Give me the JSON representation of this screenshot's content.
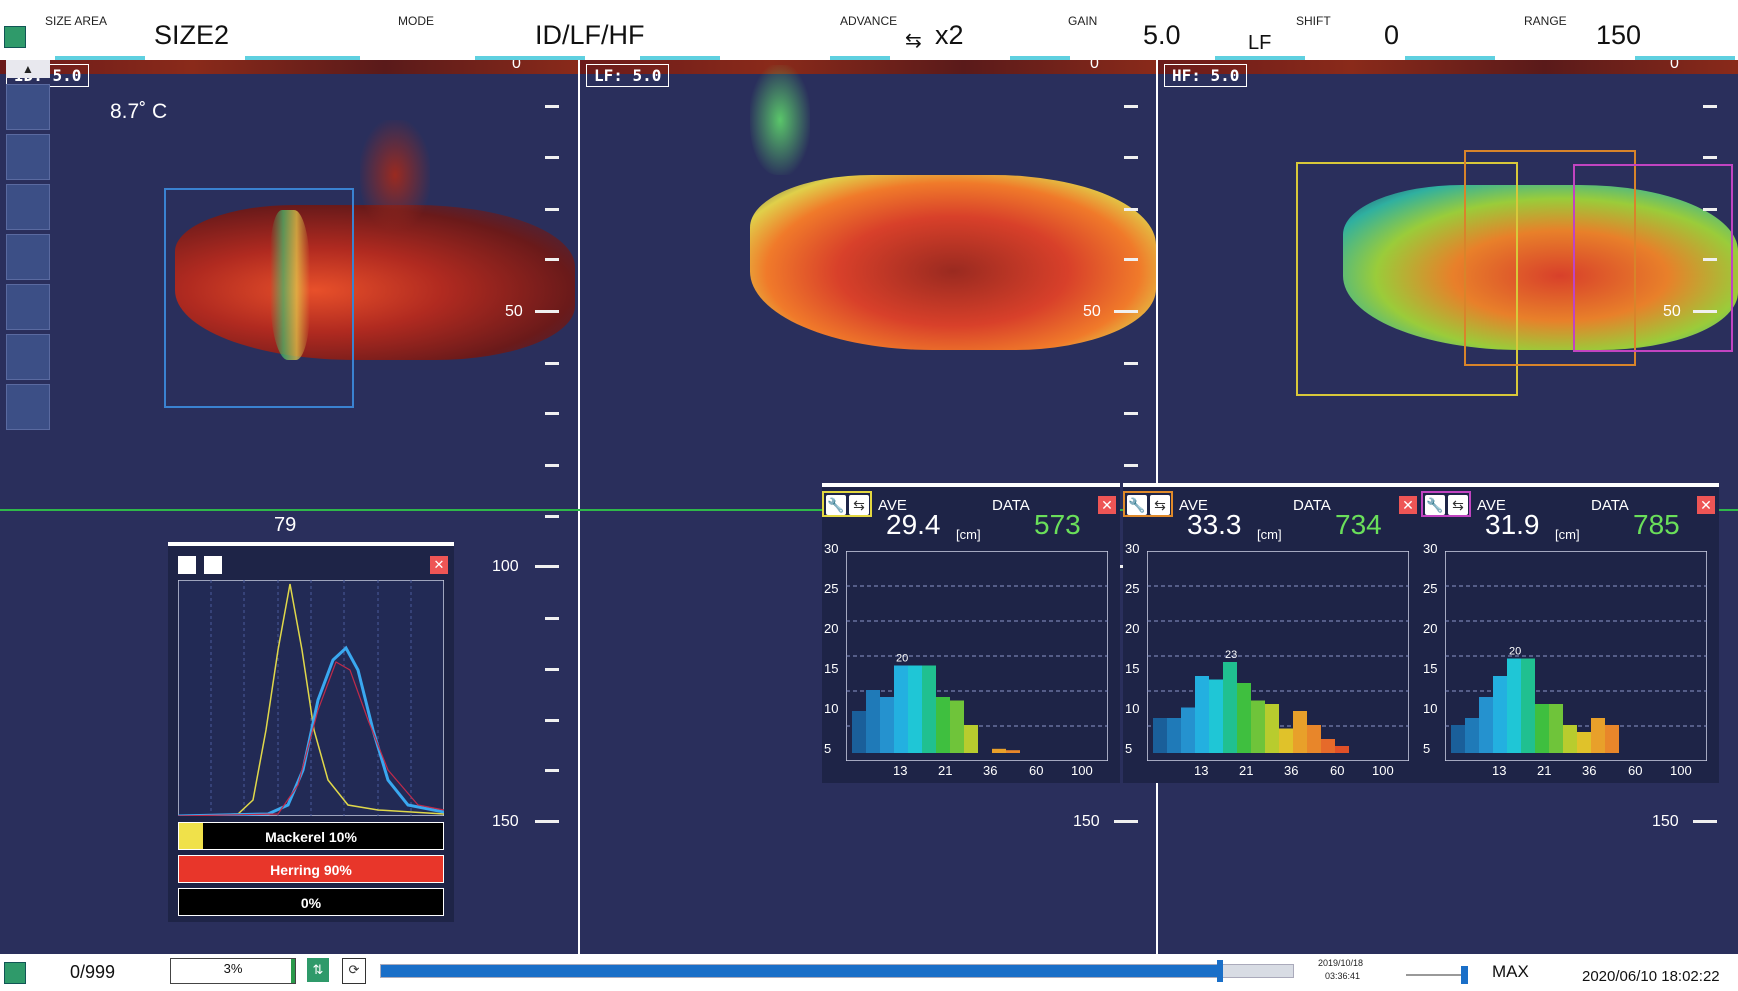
{
  "header": {
    "size_area_label": "SIZE AREA",
    "size_area_value": "SIZE2",
    "mode_label": "MODE",
    "mode_value": "ID/LF/HF",
    "advance_label": "ADVANCE",
    "advance_value": "x2",
    "gain_label": "GAIN",
    "gain_value": "5.0",
    "gain_sub": "LF",
    "shift_label": "SHIFT",
    "shift_value": "0",
    "range_label": "RANGE",
    "range_value": "150"
  },
  "panes": [
    {
      "label": "ID:   5.0",
      "scale_0": "0",
      "scale_50": "50",
      "scale_100": "100",
      "scale_150": "150"
    },
    {
      "label": "LF:   5.0",
      "scale_0": "0",
      "scale_50": "50",
      "scale_150": "150"
    },
    {
      "label": "HF:   5.0",
      "scale_0": "0",
      "scale_50": "50",
      "scale_150": "150"
    }
  ],
  "temperature": "8.7˚ C",
  "cursor_depth": "79",
  "species": {
    "rows": [
      {
        "text": "Mackerel  10%",
        "color": "#f0e14a"
      },
      {
        "text": "Herring  90%",
        "color": "#e8362a"
      },
      {
        "text": "0%",
        "color": "#000000"
      }
    ]
  },
  "size_panels": [
    {
      "ave_label": "AVE",
      "data_label": "DATA",
      "ave_value": "29.4",
      "unit": "[cm]",
      "data_value": "573",
      "frame_color": "#e3d740",
      "peak_label": "20",
      "values": [
        6,
        9,
        8,
        12.5,
        12.5,
        12.5,
        8,
        7.5,
        4,
        0,
        0.6,
        0.4,
        0,
        0,
        0,
        0
      ]
    },
    {
      "ave_label": "AVE",
      "data_label": "DATA",
      "ave_value": "33.3",
      "unit": "[cm]",
      "data_value": "734",
      "frame_color": "#e08a2a",
      "peak_label": "23",
      "values": [
        5,
        5,
        6.5,
        11,
        10.5,
        13,
        10,
        7.5,
        7,
        3.5,
        6,
        4,
        2,
        1,
        0,
        0
      ]
    },
    {
      "ave_label": "AVE",
      "data_label": "DATA",
      "ave_value": "31.9",
      "unit": "[cm]",
      "data_value": "785",
      "frame_color": "#c144c1",
      "peak_label": "20",
      "values": [
        4,
        5,
        8,
        11,
        13.5,
        13.5,
        7,
        7,
        4,
        3,
        5,
        4,
        0,
        0,
        0,
        0
      ]
    }
  ],
  "size_chart": {
    "yticks": [
      "30",
      "25",
      "20",
      "15",
      "10",
      "5"
    ],
    "xticks": [
      "13",
      "21",
      "36",
      "60",
      "100"
    ],
    "colors": [
      "#1a5f9a",
      "#1f7ab8",
      "#2592cf",
      "#23b0e0",
      "#1fc6d6",
      "#20c090",
      "#3fbf3f",
      "#6fc43a",
      "#b8cc2e",
      "#e0c22a",
      "#e8a02a",
      "#e8862a",
      "#e66a2a",
      "#e05028",
      "#d8402a",
      "#cc3028"
    ]
  },
  "footer": {
    "counter": "0/999",
    "progress": "3%",
    "timestamp_small_date": "2019/10/18",
    "timestamp_small_time": "03:36:41",
    "max_label": "MAX",
    "datetime": "2020/06/10 18:02:22",
    "playback_fraction": 0.92
  }
}
